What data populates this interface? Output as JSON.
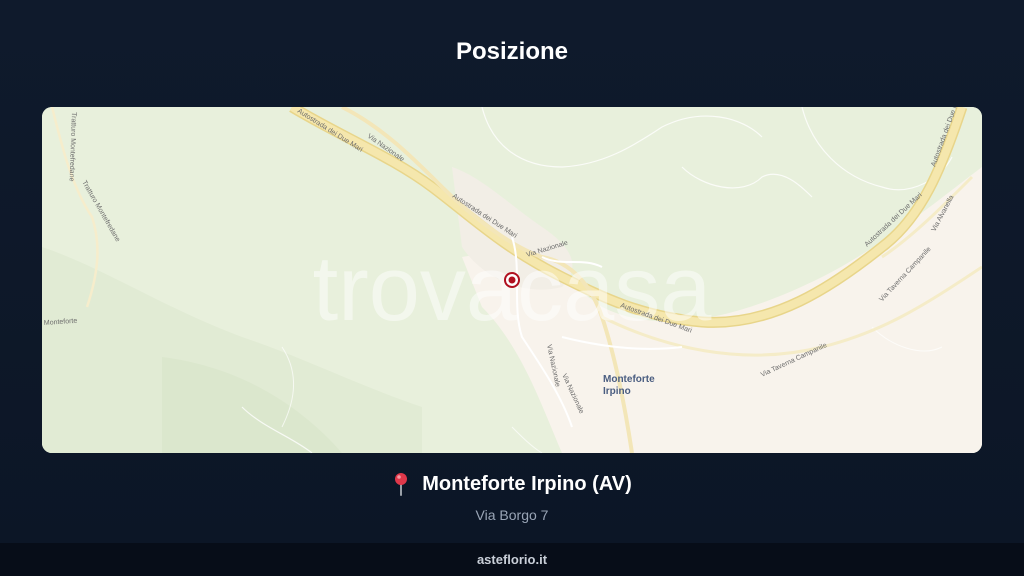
{
  "header": {
    "title": "Posizione"
  },
  "map": {
    "watermark": "trovacasa",
    "town_label_line1": "Monteforte",
    "town_label_line2": "Irpino",
    "road_labels": {
      "autostrada_a": "Autostrada dei Due Mari",
      "autostrada_b": "Autostrada dei Due Mari",
      "autostrada_c": "Autostrada dei Due Mari",
      "nazionale_a": "Via Nazionale",
      "nazionale_b": "Via Nazionale",
      "nazionale_c": "Via Nazionale",
      "nazionale_d": "Via Nazionale",
      "taverna": "Via Taverna Campanile",
      "taverna_b": "Via Taverna Campanile",
      "alvanella": "Via Alvanella",
      "tratturo_a": "Tratturo Montefredane",
      "tratturo_b": "Tratturo Montefredane",
      "monteforte": "Monteforte"
    }
  },
  "location": {
    "name": "Monteforte Irpino (AV)",
    "address": "Via Borgo 7"
  },
  "footer": {
    "site": "asteflorio.it"
  },
  "colors": {
    "background": "#0f1a2c",
    "map_green": "#e8f0dc",
    "map_urban": "#f8f3ec",
    "road_main": "#f3e3a3",
    "marker": "#b0101f"
  },
  "icons": {
    "location_pin": "round-pushpin-icon",
    "map_marker": "map-marker-icon"
  }
}
